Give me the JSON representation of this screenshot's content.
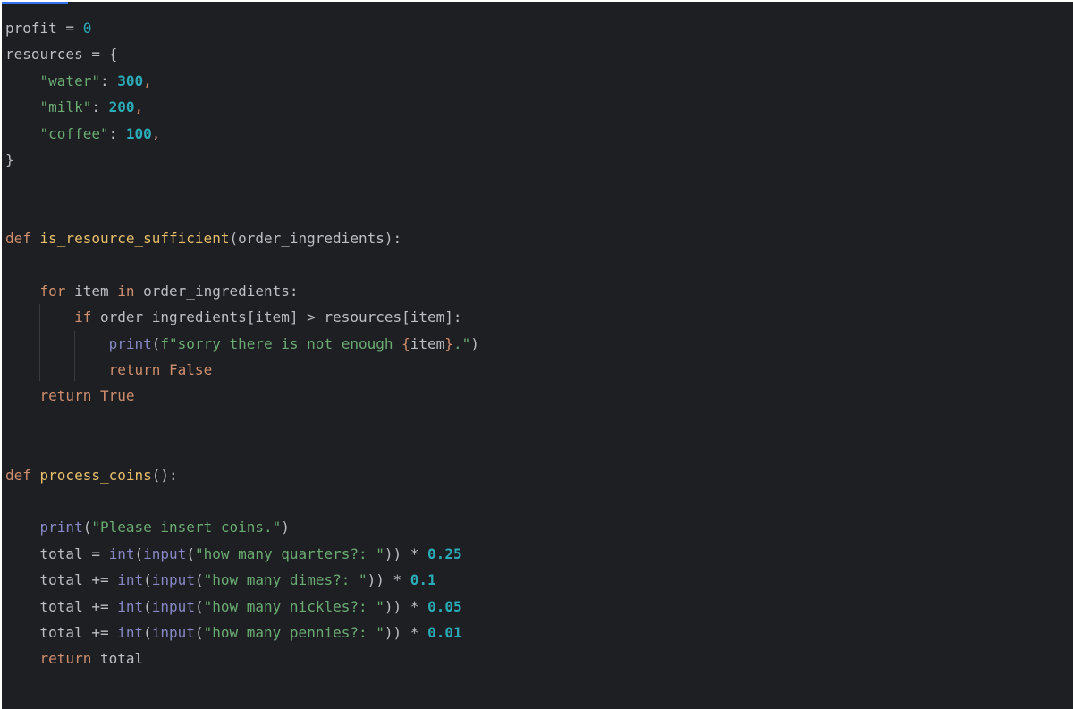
{
  "editor": {
    "language": "python",
    "colors": {
      "background": "#1e1f22",
      "keyword": "#cf8e6d",
      "function_name": "#e8bf6a",
      "string": "#6aab73",
      "number": "#2aacb8",
      "builtin": "#8888c6",
      "text": "#bcbec4"
    },
    "lines": [
      [
        {
          "t": "profit = ",
          "c": "plain"
        },
        {
          "t": "0",
          "c": "num0"
        }
      ],
      [
        {
          "t": "resources = {",
          "c": "plain"
        }
      ],
      [
        {
          "t": "    ",
          "c": "plain"
        },
        {
          "t": "\"water\"",
          "c": "str"
        },
        {
          "t": ": ",
          "c": "plain"
        },
        {
          "t": "300",
          "c": "num"
        },
        {
          "t": ",",
          "c": "kw"
        }
      ],
      [
        {
          "t": "    ",
          "c": "plain"
        },
        {
          "t": "\"milk\"",
          "c": "str"
        },
        {
          "t": ": ",
          "c": "plain"
        },
        {
          "t": "200",
          "c": "num"
        },
        {
          "t": ",",
          "c": "kw"
        }
      ],
      [
        {
          "t": "    ",
          "c": "plain"
        },
        {
          "t": "\"coffee\"",
          "c": "str"
        },
        {
          "t": ": ",
          "c": "plain"
        },
        {
          "t": "100",
          "c": "num"
        },
        {
          "t": ",",
          "c": "kw"
        }
      ],
      [
        {
          "t": "}",
          "c": "plain"
        }
      ],
      [],
      [],
      [
        {
          "t": "def ",
          "c": "kw"
        },
        {
          "t": "is_resource_sufficient",
          "c": "def-name"
        },
        {
          "t": "(order_ingredients):",
          "c": "plain"
        }
      ],
      [],
      [
        {
          "t": "    ",
          "c": "plain"
        },
        {
          "t": "for ",
          "c": "kw"
        },
        {
          "t": "item ",
          "c": "plain"
        },
        {
          "t": "in ",
          "c": "kw"
        },
        {
          "t": "order_ingredients:",
          "c": "plain"
        }
      ],
      [
        {
          "t": "        ",
          "c": "plain"
        },
        {
          "t": "if ",
          "c": "kw"
        },
        {
          "t": "order_ingredients[item] > resources[item]:",
          "c": "plain"
        }
      ],
      [
        {
          "t": "            ",
          "c": "plain"
        },
        {
          "t": "print",
          "c": "builtin"
        },
        {
          "t": "(",
          "c": "plain"
        },
        {
          "t": "f\"sorry there is not enough ",
          "c": "str"
        },
        {
          "t": "{",
          "c": "kw"
        },
        {
          "t": "item",
          "c": "plain"
        },
        {
          "t": "}",
          "c": "kw"
        },
        {
          "t": ".\"",
          "c": "str"
        },
        {
          "t": ")",
          "c": "plain"
        }
      ],
      [
        {
          "t": "            ",
          "c": "plain"
        },
        {
          "t": "return ",
          "c": "kw"
        },
        {
          "t": "False",
          "c": "kw"
        }
      ],
      [
        {
          "t": "    ",
          "c": "plain"
        },
        {
          "t": "return ",
          "c": "kw"
        },
        {
          "t": "True",
          "c": "kw"
        }
      ],
      [],
      [],
      [
        {
          "t": "def ",
          "c": "kw"
        },
        {
          "t": "process_coins",
          "c": "def-name"
        },
        {
          "t": "():",
          "c": "plain"
        }
      ],
      [],
      [
        {
          "t": "    ",
          "c": "plain"
        },
        {
          "t": "print",
          "c": "builtin"
        },
        {
          "t": "(",
          "c": "plain"
        },
        {
          "t": "\"Please insert coins.\"",
          "c": "str"
        },
        {
          "t": ")",
          "c": "plain"
        }
      ],
      [
        {
          "t": "    ",
          "c": "plain"
        },
        {
          "t": "total = ",
          "c": "plain"
        },
        {
          "t": "int",
          "c": "builtin"
        },
        {
          "t": "(",
          "c": "plain"
        },
        {
          "t": "input",
          "c": "builtin"
        },
        {
          "t": "(",
          "c": "plain"
        },
        {
          "t": "\"how many quarters?: \"",
          "c": "str"
        },
        {
          "t": ")) * ",
          "c": "plain"
        },
        {
          "t": "0.25",
          "c": "num"
        }
      ],
      [
        {
          "t": "    ",
          "c": "plain"
        },
        {
          "t": "total += ",
          "c": "plain"
        },
        {
          "t": "int",
          "c": "builtin"
        },
        {
          "t": "(",
          "c": "plain"
        },
        {
          "t": "input",
          "c": "builtin"
        },
        {
          "t": "(",
          "c": "plain"
        },
        {
          "t": "\"how many dimes?: \"",
          "c": "str"
        },
        {
          "t": ")) * ",
          "c": "plain"
        },
        {
          "t": "0.1",
          "c": "num"
        }
      ],
      [
        {
          "t": "    ",
          "c": "plain"
        },
        {
          "t": "total += ",
          "c": "plain"
        },
        {
          "t": "int",
          "c": "builtin"
        },
        {
          "t": "(",
          "c": "plain"
        },
        {
          "t": "input",
          "c": "builtin"
        },
        {
          "t": "(",
          "c": "plain"
        },
        {
          "t": "\"how many nickles?: \"",
          "c": "str"
        },
        {
          "t": ")) * ",
          "c": "plain"
        },
        {
          "t": "0.05",
          "c": "num"
        }
      ],
      [
        {
          "t": "    ",
          "c": "plain"
        },
        {
          "t": "total += ",
          "c": "plain"
        },
        {
          "t": "int",
          "c": "builtin"
        },
        {
          "t": "(",
          "c": "plain"
        },
        {
          "t": "input",
          "c": "builtin"
        },
        {
          "t": "(",
          "c": "plain"
        },
        {
          "t": "\"how many pennies?: \"",
          "c": "str"
        },
        {
          "t": ")) * ",
          "c": "plain"
        },
        {
          "t": "0.01",
          "c": "num"
        }
      ],
      [
        {
          "t": "    ",
          "c": "plain"
        },
        {
          "t": "return ",
          "c": "kw"
        },
        {
          "t": "total",
          "c": "plain"
        }
      ]
    ]
  }
}
